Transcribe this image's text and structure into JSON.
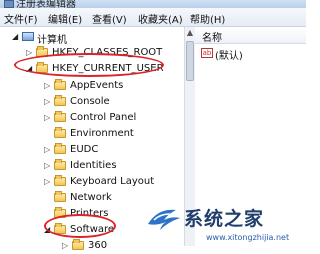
{
  "window": {
    "title": "注册表编辑器"
  },
  "menu": [
    "文件(F)",
    "编辑(E)",
    "查看(V)",
    "收藏夹(A)",
    "帮助(H)"
  ],
  "tree": [
    {
      "label": "计算机",
      "icon": "computer-icon",
      "expanded": true
    },
    {
      "label": "HKEY_CLASSES_ROOT",
      "icon": "folder-icon",
      "expanded": false
    },
    {
      "label": "HKEY_CURRENT_USER",
      "icon": "folder-icon",
      "expanded": true,
      "highlighted": true
    },
    {
      "label": "AppEvents",
      "icon": "folder-icon",
      "expanded": false
    },
    {
      "label": "Console",
      "icon": "folder-icon",
      "expanded": false
    },
    {
      "label": "Control Panel",
      "icon": "folder-icon",
      "expanded": false
    },
    {
      "label": "Environment",
      "icon": "folder-icon",
      "expanded": false
    },
    {
      "label": "EUDC",
      "icon": "folder-icon",
      "expanded": false
    },
    {
      "label": "Identities",
      "icon": "folder-icon",
      "expanded": false
    },
    {
      "label": "Keyboard Layout",
      "icon": "folder-icon",
      "expanded": false
    },
    {
      "label": "Network",
      "icon": "folder-icon",
      "expanded": false
    },
    {
      "label": "Printers",
      "icon": "folder-icon",
      "expanded": false
    },
    {
      "label": "Software",
      "icon": "folder-icon",
      "expanded": true,
      "highlighted": true
    },
    {
      "label": "360",
      "icon": "folder-icon",
      "expanded": false
    }
  ],
  "right_pane": {
    "column_header": "名称",
    "values": [
      {
        "label": "(默认)",
        "icon": "ab-string-icon",
        "icon_text": "ab"
      }
    ]
  },
  "watermark": {
    "text": "系统之家",
    "url": "www.xitongzhijia.net"
  },
  "colors": {
    "annotation": "#d8252c",
    "folder": "#f2c75a",
    "watermark_text": "#1f3e6b"
  }
}
